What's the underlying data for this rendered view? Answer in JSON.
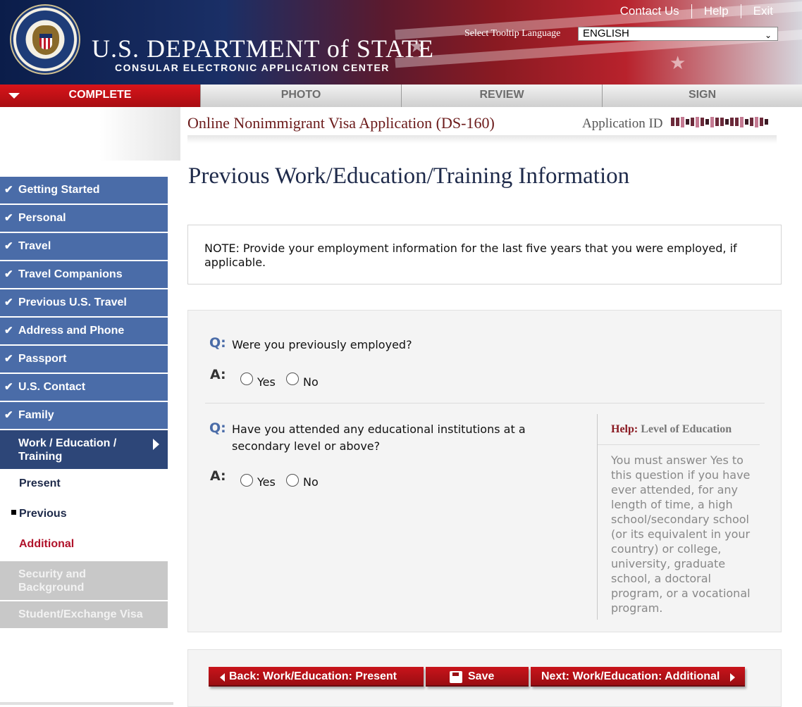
{
  "header": {
    "links": [
      "Contact Us",
      "Help",
      "Exit"
    ],
    "dept_title": "U.S. DEPARTMENT of STATE",
    "dept_subtitle": "CONSULAR ELECTRONIC APPLICATION CENTER",
    "tooltip_label": "Select Tooltip Language",
    "language": "ENGLISH"
  },
  "steps": [
    "COMPLETE",
    "PHOTO",
    "REVIEW",
    "SIGN"
  ],
  "app": {
    "title": "Online Nonimmigrant Visa Application (DS-160)",
    "id_label": "Application ID"
  },
  "page_title": "Previous Work/Education/Training Information",
  "sidebar": {
    "completed": [
      "Getting Started",
      "Personal",
      "Travel",
      "Travel Companions",
      "Previous U.S. Travel",
      "Address and Phone",
      "Passport",
      "U.S. Contact",
      "Family"
    ],
    "current": [
      "Work / Education /",
      "Training"
    ],
    "sub_items": [
      "Present",
      "Previous",
      "Additional"
    ],
    "disabled": [
      [
        "Security and",
        "Background"
      ],
      "Student/Exchange Visa"
    ]
  },
  "note": "NOTE: Provide your employment information for the last five years that you were employed, if applicable.",
  "questions": [
    {
      "q": "Q:",
      "a": "A:",
      "text": "Were you previously employed?",
      "yes": "Yes",
      "no": "No"
    },
    {
      "q": "Q:",
      "a": "A:",
      "text_lines": [
        "Have you attended any educational institutions at a",
        "secondary level or above?"
      ],
      "yes": "Yes",
      "no": "No"
    }
  ],
  "help": {
    "prefix": "Help:",
    "title": "Level of Education",
    "text": "You must answer Yes to this question if you have ever attended, for any length of time, a high school/secondary school (or its equivalent in your country) or college, university, graduate school, a doctoral program, or a vocational program."
  },
  "buttons": {
    "back": "Back: Work/Education: Present",
    "save": "Save",
    "next": "Next: Work/Education: Additional"
  },
  "colors": {
    "nav_blue": "#4a6ca8",
    "nav_current": "#2d4678",
    "button_red": "#c9141b",
    "active_step": "#d8141a"
  }
}
